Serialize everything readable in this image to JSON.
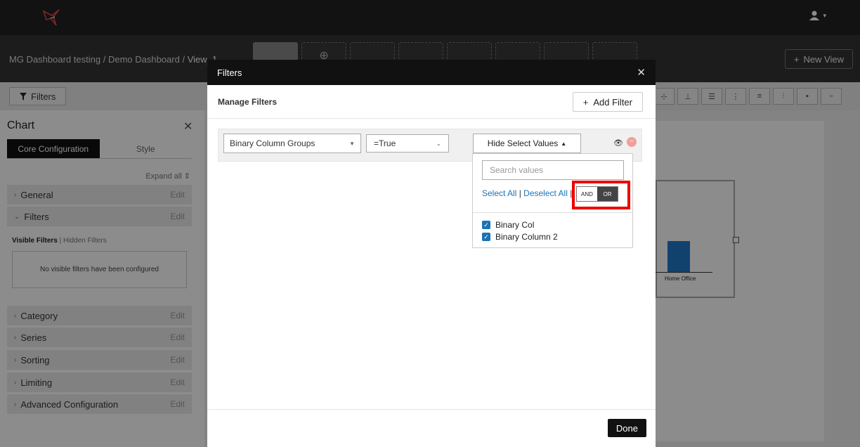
{
  "header": {
    "user_menu_caret": "▾"
  },
  "subbar": {
    "breadcrumb_1": "MG Dashboard testing",
    "breadcrumb_2": "Demo Dashboard",
    "breadcrumb_current": "View_1",
    "separator": "/",
    "new_view_label": "New View",
    "add_view_glyph": "⊕"
  },
  "toolbar": {
    "filters_label": "Filters"
  },
  "left_panel": {
    "title": "Chart",
    "tab_core": "Core Configuration",
    "tab_style": "Style",
    "expand_all": "Expand all",
    "edit_label": "Edit",
    "sections": {
      "general": "General",
      "filters": "Filters",
      "category": "Category",
      "series": "Series",
      "sorting": "Sorting",
      "limiting": "Limiting",
      "advanced": "Advanced Configuration"
    },
    "visible_filters": "Visible Filters",
    "hidden_filters": "Hidden Filters",
    "no_filters_msg": "No visible filters have been configured"
  },
  "canvas": {
    "category_label": "Home Office"
  },
  "modal": {
    "title": "Filters",
    "manage_title": "Manage Filters",
    "add_filter_label": "Add Filter",
    "filter_field": "Binary Column Groups",
    "filter_op": "=True",
    "hide_select_label": "Hide Select Values",
    "search_placeholder": "Search values",
    "select_all": "Select All",
    "deselect_all": "Deselect All",
    "and_label": "AND",
    "or_label": "OR",
    "values": [
      {
        "label": "Binary Col",
        "checked": true
      },
      {
        "label": "Binary Column 2",
        "checked": true
      }
    ],
    "done_label": "Done"
  },
  "colors": {
    "accent": "#1a73b8",
    "highlight": "#e00000",
    "bar": "#1f78c8"
  }
}
